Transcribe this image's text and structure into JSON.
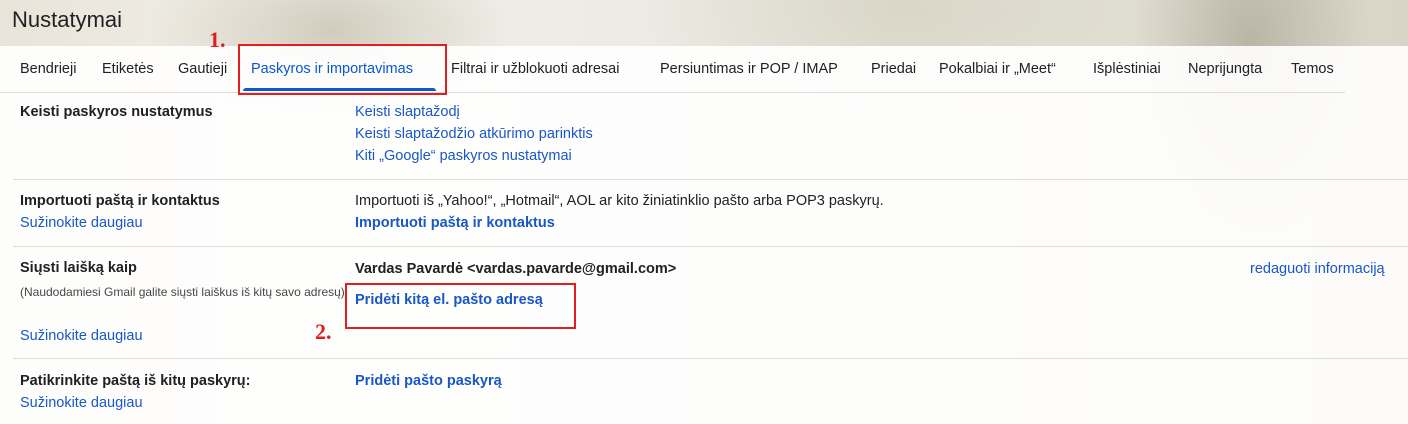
{
  "page_title": "Nustatymai",
  "tabs": [
    {
      "label": "Bendrieji",
      "active": false
    },
    {
      "label": "Etiketės",
      "active": false
    },
    {
      "label": "Gautieji",
      "active": false
    },
    {
      "label": "Paskyros ir importavimas",
      "active": true
    },
    {
      "label": "Filtrai ir užblokuoti adresai",
      "active": false
    },
    {
      "label": "Persiuntimas ir POP / IMAP",
      "active": false
    },
    {
      "label": "Priedai",
      "active": false
    },
    {
      "label": "Pokalbiai ir „Meet“",
      "active": false
    },
    {
      "label": "Išplėstiniai",
      "active": false
    },
    {
      "label": "Neprijungta",
      "active": false
    },
    {
      "label": "Temos",
      "active": false
    }
  ],
  "annotations": {
    "step1": "1.",
    "step2": "2.",
    "color": "#e02020"
  },
  "sections": {
    "change_account": {
      "label": "Keisti paskyros nustatymus",
      "links": [
        "Keisti slaptažodį",
        "Keisti slaptažodžio atkūrimo parinktis",
        "Kiti „Google“ paskyros nustatymai"
      ]
    },
    "import": {
      "label": "Importuoti paštą ir kontaktus",
      "learn_more": "Sužinokite daugiau",
      "description": "Importuoti iš „Yahoo!“, „Hotmail“, AOL ar kito žiniatinklio pašto arba POP3 paskyrų.",
      "action": "Importuoti paštą ir kontaktus"
    },
    "send_as": {
      "label": "Siųsti laišką kaip",
      "description": "(Naudodamiesi Gmail galite siųsti laiškus iš kitų savo adresų)",
      "learn_more": "Sužinokite daugiau",
      "address": "Vardas Pavardė <vardas.pavarde@gmail.com>",
      "edit": "redaguoti informaciją",
      "action": "Pridėti kitą el. pašto adresą"
    },
    "check_mail": {
      "label": "Patikrinkite paštą iš kitų paskyrų:",
      "learn_more": "Sužinokite daugiau",
      "action": "Pridėti pašto paskyrą"
    }
  },
  "colors": {
    "accent": "#0b57d0",
    "link": "#1a57c6",
    "text": "#202124",
    "divider": "#dadce0"
  }
}
